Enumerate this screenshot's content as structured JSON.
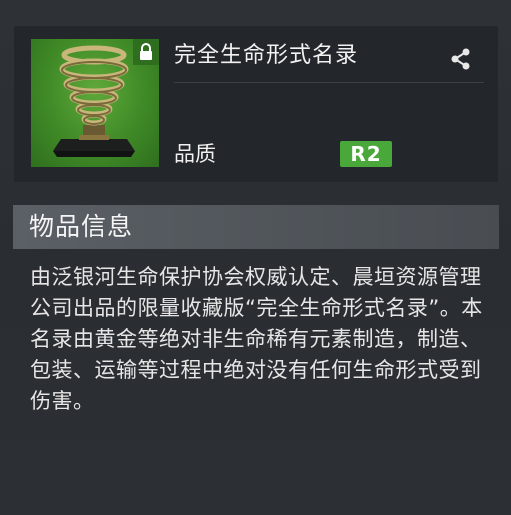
{
  "item": {
    "name": "完全生命形式名录",
    "quality_label": "品质",
    "quality_grade": "R2",
    "icons": {
      "lock": "lock-icon",
      "share": "share-icon"
    }
  },
  "info": {
    "section_title": "物品信息",
    "description": "由泛银河生命保护协会权威认定、晨垣资源管理公司出品的限量收藏版“完全生命形式名录”。本名录由黄金等绝对非生命稀有元素制造，制造、包装、运输等过程中绝对没有任何生命形式受到伤害。"
  },
  "colors": {
    "background": "#2b2f33",
    "card": "#23272b",
    "thumbnail_green": "#4a9a30",
    "badge_green": "#4aa83a",
    "section_bar": "#565b60"
  }
}
